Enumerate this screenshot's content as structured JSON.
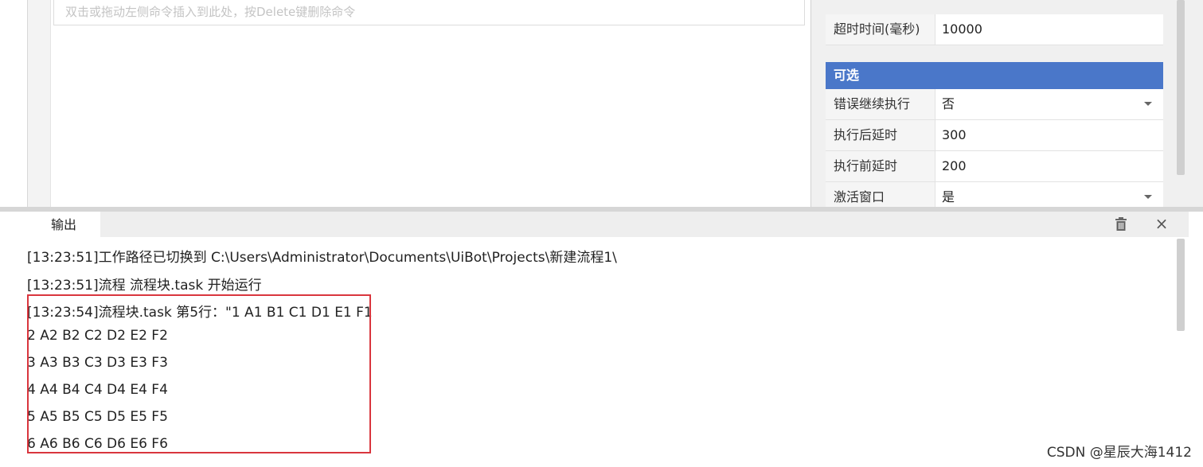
{
  "canvas": {
    "hint": "双击或拖动左侧命令插入到此处，按Delete键删除命令"
  },
  "properties": {
    "timeout_row": {
      "key": "超时时间(毫秒)",
      "value": "10000"
    },
    "optional_section": "可选",
    "optional_rows": [
      {
        "key": "错误继续执行",
        "value": "否",
        "dropdown": true
      },
      {
        "key": "执行后延时",
        "value": "300",
        "dropdown": false
      },
      {
        "key": "执行前延时",
        "value": "200",
        "dropdown": false
      },
      {
        "key": "激活窗口",
        "value": "是",
        "dropdown": true
      }
    ]
  },
  "output": {
    "tab_label": "输出",
    "trash_icon": "trash-icon",
    "close_label": "×",
    "lines": [
      "[13:23:51]工作路径已切换到 C:\\Users\\Administrator\\Documents\\UiBot\\Projects\\新建流程1\\",
      "[13:23:51]流程 流程块.task 开始运行",
      "[13:23:54]流程块.task 第5行：\"1 A1 B1 C1 D1 E1 F1",
      "2 A2 B2 C2 D2 E2 F2",
      "3 A3 B3 C3 D3 E3 F3",
      "4 A4 B4 C4 D4 E4 F4",
      "5 A5 B5 C5 D5 E5 F5",
      "6 A6 B6 C6 D6 E6 F6"
    ]
  },
  "watermark": "CSDN @星辰大海1412",
  "colors": {
    "section_header": "#4a77c9",
    "highlight_border": "#d9363e"
  }
}
